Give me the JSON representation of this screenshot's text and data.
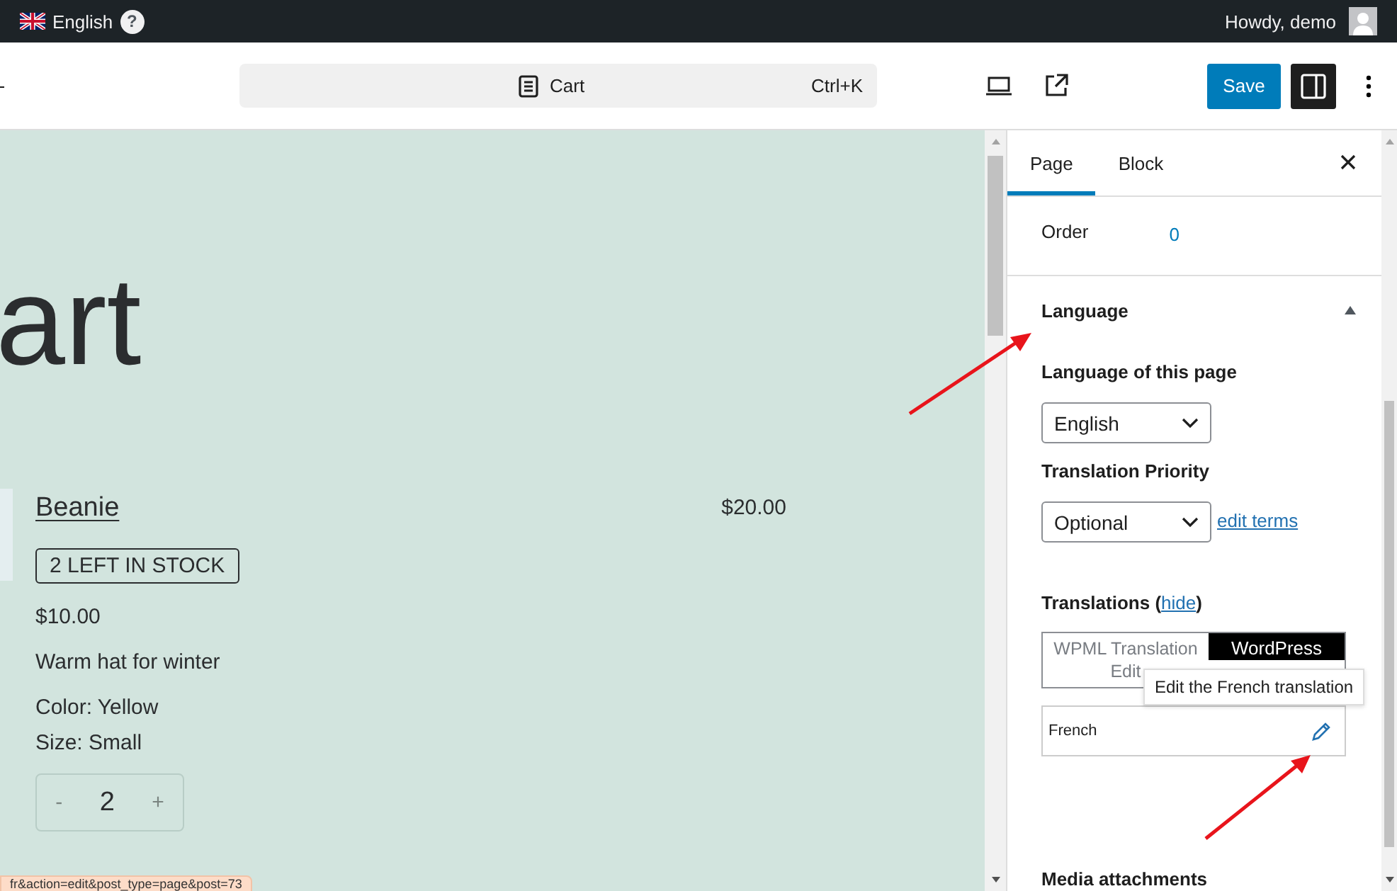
{
  "admin_bar": {
    "language": "English",
    "help": "?",
    "greeting": "Howdy, demo"
  },
  "header": {
    "search": {
      "title": "Cart",
      "shortcut": "Ctrl+K"
    },
    "save": "Save",
    "sidebar_toggle": {
      "on": true
    }
  },
  "canvas": {
    "title": "art",
    "item": {
      "name": "Beanie",
      "total": "$20.00",
      "stock": "2 LEFT IN STOCK",
      "price": "$10.00",
      "description": "Warm hat for winter",
      "attributes": [
        "Color: Yellow",
        "Size: Small"
      ],
      "quantity": {
        "minus": "-",
        "value": "2",
        "plus": "+"
      }
    }
  },
  "sidebar": {
    "tabs": [
      {
        "label": "Page",
        "selected": true
      },
      {
        "label": "Block",
        "selected": false
      }
    ],
    "order": {
      "label": "Order",
      "value": "0"
    },
    "language_panel": {
      "title": "Language",
      "expanded": true,
      "page_language": {
        "label": "Language of this page",
        "value": "English"
      },
      "priority": {
        "label": "Translation Priority",
        "value": "Optional",
        "link": "edit terms"
      },
      "translations": {
        "before": "Translations (",
        "link": "hide",
        "after": ")",
        "editor_tabs": [
          {
            "label": "WPML Translation Edit",
            "selected": false
          },
          {
            "label": "WordPress",
            "selected": true
          }
        ],
        "languages": [
          {
            "name": "French"
          }
        ],
        "tooltip": "Edit the French translation"
      }
    },
    "next_panel": "Media attachments"
  },
  "status_url": "fr&action=edit&post_type=page&post=73"
}
